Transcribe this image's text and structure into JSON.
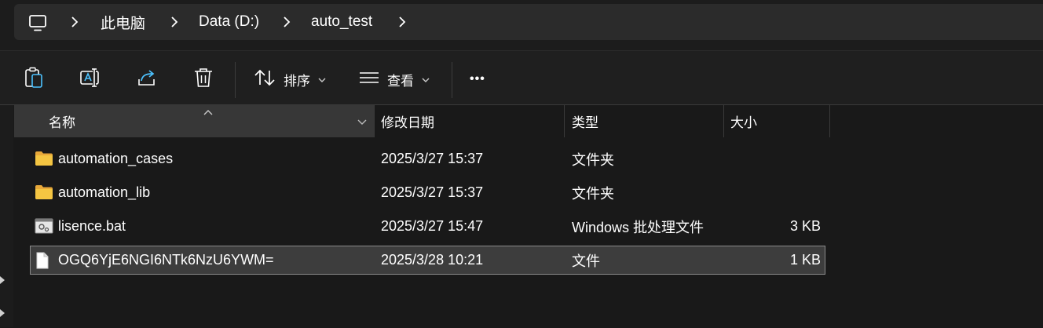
{
  "breadcrumb": {
    "pc_icon": "computer-icon",
    "items": [
      "此电脑",
      "Data (D:)",
      "auto_test"
    ]
  },
  "toolbar": {
    "sort_label": "排序",
    "view_label": "查看",
    "more_label": "•••"
  },
  "columns": {
    "name": "名称",
    "modified": "修改日期",
    "type": "类型",
    "size": "大小"
  },
  "files": [
    {
      "name": "automation_cases",
      "modified": "2025/3/27 15:37",
      "type": "文件夹",
      "size": "",
      "icon": "folder-icon"
    },
    {
      "name": "automation_lib",
      "modified": "2025/3/27 15:37",
      "type": "文件夹",
      "size": "",
      "icon": "folder-icon"
    },
    {
      "name": "lisence.bat",
      "modified": "2025/3/27 15:47",
      "type": "Windows 批处理文件",
      "size": "3 KB",
      "icon": "batch-file-icon"
    },
    {
      "name": "OGQ6YjE6NGI6NTk6NzU6YWM=",
      "modified": "2025/3/28 10:21",
      "type": "文件",
      "size": "1 KB",
      "icon": "file-icon",
      "selected": true
    }
  ],
  "colors": {
    "folder": "#f4c542",
    "accent": "#4cc2ff",
    "selection": "#3d3d3d"
  }
}
